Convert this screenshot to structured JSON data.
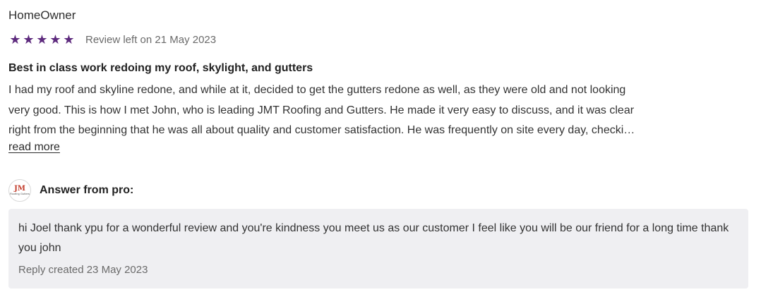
{
  "review": {
    "author": "HomeOwner",
    "rating": 5,
    "rating_max": 5,
    "star_icon": "star-icon",
    "star_color": "#5e2b7e",
    "date_text": "Review left on 21 May 2023",
    "title": "Best in class work redoing my roof, skylight, and gutters",
    "body_lines": [
      "I had my roof and skyline redone, and while at it, decided to get the gutters redone as well, as they were old and not looking",
      "very good.  This is how I met John, who is leading JMT Roofing and Gutters. He made it very easy to discuss, and it was clear",
      "right from the beginning that he was all about quality and customer satisfaction. He was frequently on site every day, checki…"
    ],
    "read_more_label": "read more"
  },
  "pro_answer": {
    "logo_text": "JM",
    "logo_subtext": "Roofing Gutters",
    "label": "Answer from pro:",
    "reply_text": "hi Joel thank ypu for a wonderful review and you're kindness you meet us as our customer I feel like you will be our friend for a long time thank you john",
    "reply_date": "Reply created 23 May 2023",
    "reply_bg": "#efeff2"
  }
}
